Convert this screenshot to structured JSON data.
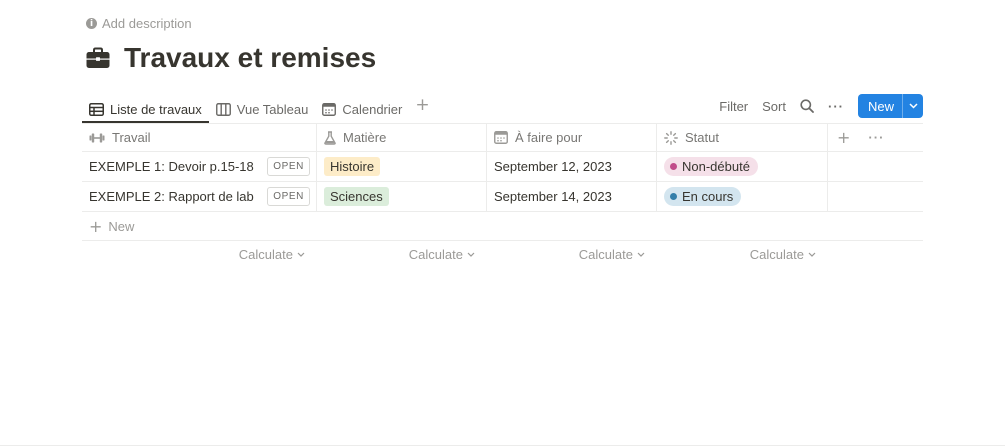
{
  "description": {
    "label": "Add description",
    "icon": "info-icon"
  },
  "page": {
    "title": "Travaux et remises",
    "icon": "briefcase-icon"
  },
  "tabs": [
    {
      "label": "Liste de travaux",
      "icon": "table-icon",
      "active": true
    },
    {
      "label": "Vue Tableau",
      "icon": "board-icon",
      "active": false
    },
    {
      "label": "Calendrier",
      "icon": "calendar-icon",
      "active": false
    }
  ],
  "toolbar": {
    "filter": "Filter",
    "sort": "Sort",
    "more": "···",
    "new": "New"
  },
  "columns": [
    {
      "label": "Travail",
      "icon": "dumbbell-icon"
    },
    {
      "label": "Matière",
      "icon": "flask-icon"
    },
    {
      "label": "À faire pour",
      "icon": "calendar-icon"
    },
    {
      "label": "Statut",
      "icon": "loading-icon"
    }
  ],
  "rows": [
    {
      "travail": "EXEMPLE 1: Devoir p.15-18",
      "open": "OPEN",
      "matiere": "Histoire",
      "date": "September 12, 2023",
      "statut": "Non-débuté"
    },
    {
      "travail": "EXEMPLE 2: Rapport de lab",
      "open": "OPEN",
      "matiere": "Sciences",
      "date": "September 14, 2023",
      "statut": "En cours"
    }
  ],
  "new_row": "New",
  "calculate": "Calculate",
  "colors": {
    "accent": "#2383e2",
    "histoire_bg": "#fdecc8",
    "sciences_bg": "#dbeddb",
    "non_debute_bg": "#f5e0e9",
    "non_debute_dot": "#c14c8a",
    "en_cours_bg": "#d3e5ef",
    "en_cours_dot": "#337ea9"
  }
}
